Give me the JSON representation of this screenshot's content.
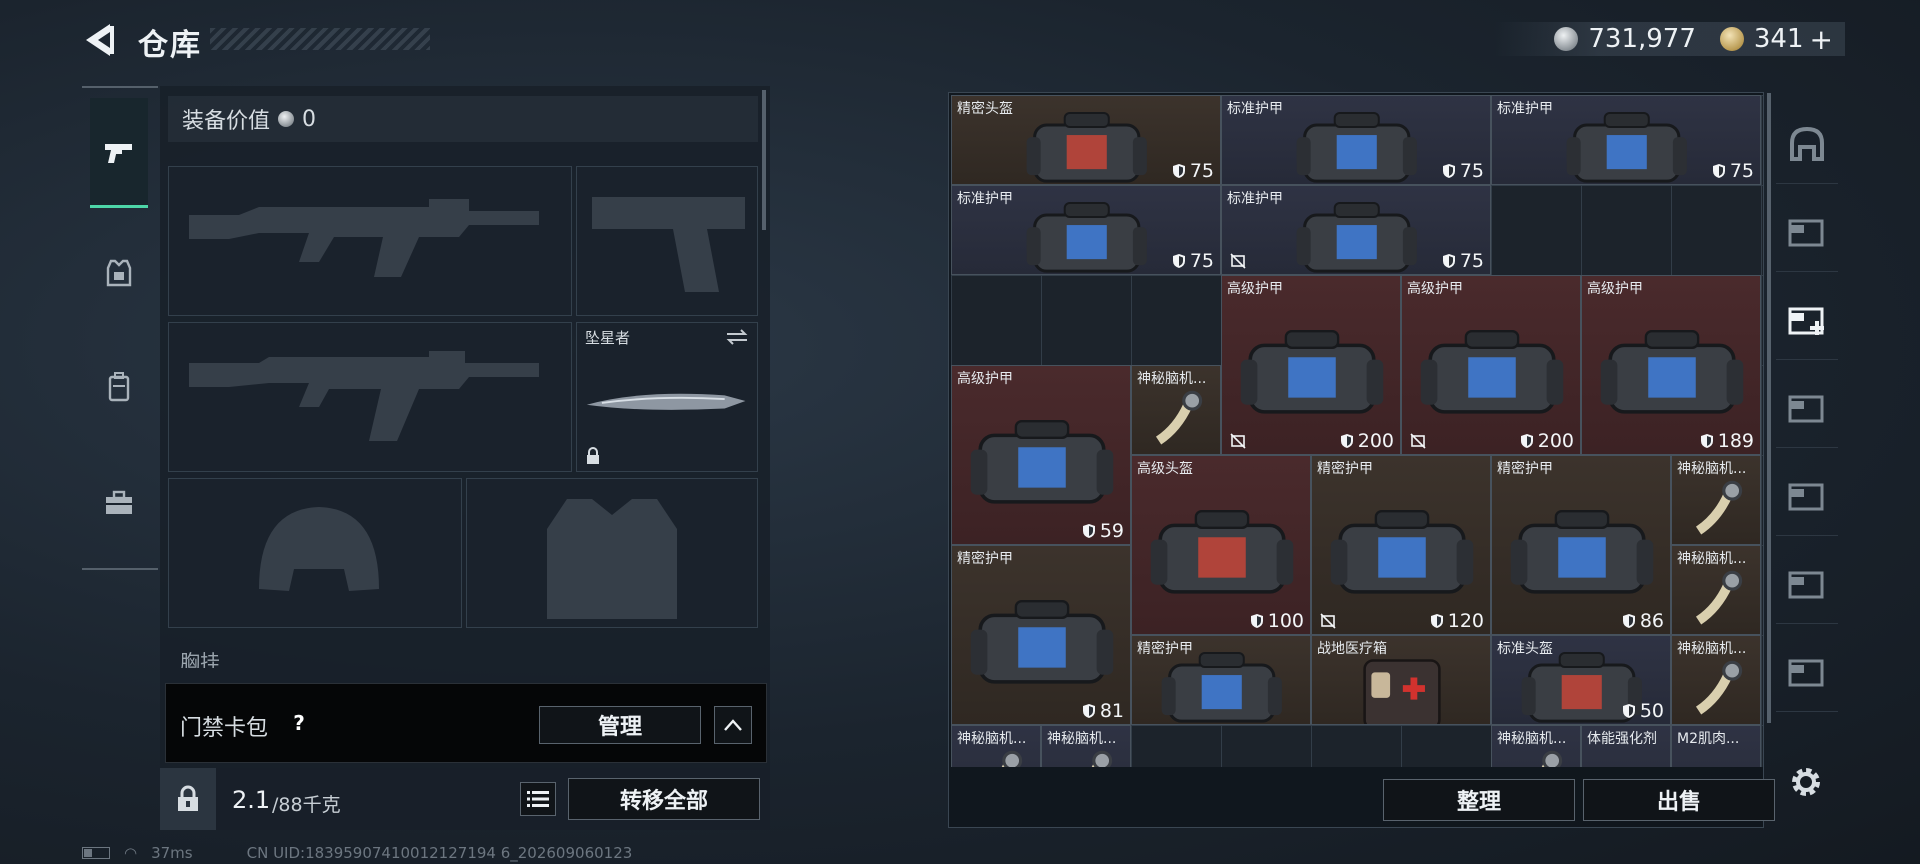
{
  "header": {
    "title": "仓库",
    "currency_silver": "731,977",
    "currency_gold": "341",
    "currency_plus": "+"
  },
  "left_tabs": [
    {
      "icon": "pistol-icon",
      "active": true
    },
    {
      "icon": "armor-vest-icon",
      "active": false
    },
    {
      "icon": "backpack-icon",
      "active": false
    },
    {
      "icon": "toolbox-icon",
      "active": false
    }
  ],
  "equipment": {
    "value_label": "装备价值",
    "value": "0",
    "knife_name": "坠星者",
    "chest_label": "胸挂"
  },
  "access_card": {
    "label": "门禁卡包",
    "help": "?",
    "manage": "管理"
  },
  "weight": {
    "current": "2.1",
    "max": "/88千克",
    "transfer_all": "转移全部"
  },
  "status": {
    "ping": "37ms",
    "uid": "CN UID:18395907410012127194 6_202609060123"
  },
  "stash": {
    "items": [
      {
        "name": "精密头盔",
        "dur": "75",
        "color": "brown",
        "kind": "bag-red",
        "flag": false
      },
      {
        "name": "标准护甲",
        "dur": "75",
        "color": "navy",
        "kind": "bag",
        "flag": false
      },
      {
        "name": "标准护甲",
        "dur": "75",
        "color": "navy",
        "kind": "bag",
        "flag": false
      },
      {
        "name": "标准护甲",
        "dur": "75",
        "color": "navy",
        "kind": "bag",
        "flag": false
      },
      {
        "name": "标准护甲",
        "dur": "75",
        "color": "navy",
        "kind": "bag",
        "flag": true
      },
      {
        "name": "高级护甲",
        "dur": "200",
        "color": "red",
        "kind": "bag",
        "flag": true
      },
      {
        "name": "高级护甲",
        "dur": "200",
        "color": "red",
        "kind": "bag",
        "flag": true
      },
      {
        "name": "高级护甲",
        "dur": "189",
        "color": "red",
        "kind": "bag",
        "flag": false
      },
      {
        "name": "高级护甲",
        "dur": "59",
        "color": "red",
        "kind": "bag",
        "flag": false
      },
      {
        "name": "神秘脑机...",
        "dur": "",
        "color": "brown",
        "kind": "chip",
        "flag": false
      },
      {
        "name": "高级头盔",
        "dur": "100",
        "color": "red",
        "kind": "bag-red",
        "flag": false
      },
      {
        "name": "精密护甲",
        "dur": "120",
        "color": "brown",
        "kind": "bag",
        "flag": true
      },
      {
        "name": "精密护甲",
        "dur": "86",
        "color": "brown",
        "kind": "bag",
        "flag": false
      },
      {
        "name": "神秘脑机...",
        "dur": "",
        "color": "brown",
        "kind": "chip",
        "flag": false
      },
      {
        "name": "神秘脑机...",
        "dur": "",
        "color": "brown",
        "kind": "chip",
        "flag": false
      },
      {
        "name": "精密护甲",
        "dur": "81",
        "color": "brown",
        "kind": "bag",
        "flag": false
      },
      {
        "name": "精密护甲",
        "dur": "",
        "color": "brown",
        "kind": "bag",
        "flag": false
      },
      {
        "name": "战地医疗箱",
        "dur": "",
        "color": "brown",
        "kind": "medkit",
        "flag": false
      },
      {
        "name": "标准头盔",
        "dur": "50",
        "color": "navy",
        "kind": "bag-red",
        "flag": false
      },
      {
        "name": "神秘脑机...",
        "dur": "",
        "color": "brown",
        "kind": "chip",
        "flag": false
      },
      {
        "name": "神秘脑机...",
        "dur": "",
        "color": "navy",
        "kind": "chip",
        "flag": false
      },
      {
        "name": "神秘脑机...",
        "dur": "",
        "color": "navy",
        "kind": "chip",
        "flag": false
      },
      {
        "name": "神秘脑机...",
        "dur": "",
        "color": "navy",
        "kind": "chip",
        "flag": false
      },
      {
        "name": "体能强化剂",
        "dur": "",
        "color": "navy",
        "kind": "syringe",
        "flag": false
      },
      {
        "name": "M2肌肉...",
        "dur": "",
        "color": "navy",
        "kind": "syringe",
        "flag": false
      }
    ],
    "sort": "整理",
    "sell": "出售"
  },
  "right_rail": [
    {
      "icon": "helmet-slot-icon"
    },
    {
      "icon": "case-iv-icon"
    },
    {
      "icon": "case-iv-plus-icon"
    },
    {
      "icon": "gti-case-1-icon"
    },
    {
      "icon": "gti-case-2-icon"
    },
    {
      "icon": "gti-case-3-icon"
    },
    {
      "icon": "gti-case-4-icon"
    }
  ]
}
